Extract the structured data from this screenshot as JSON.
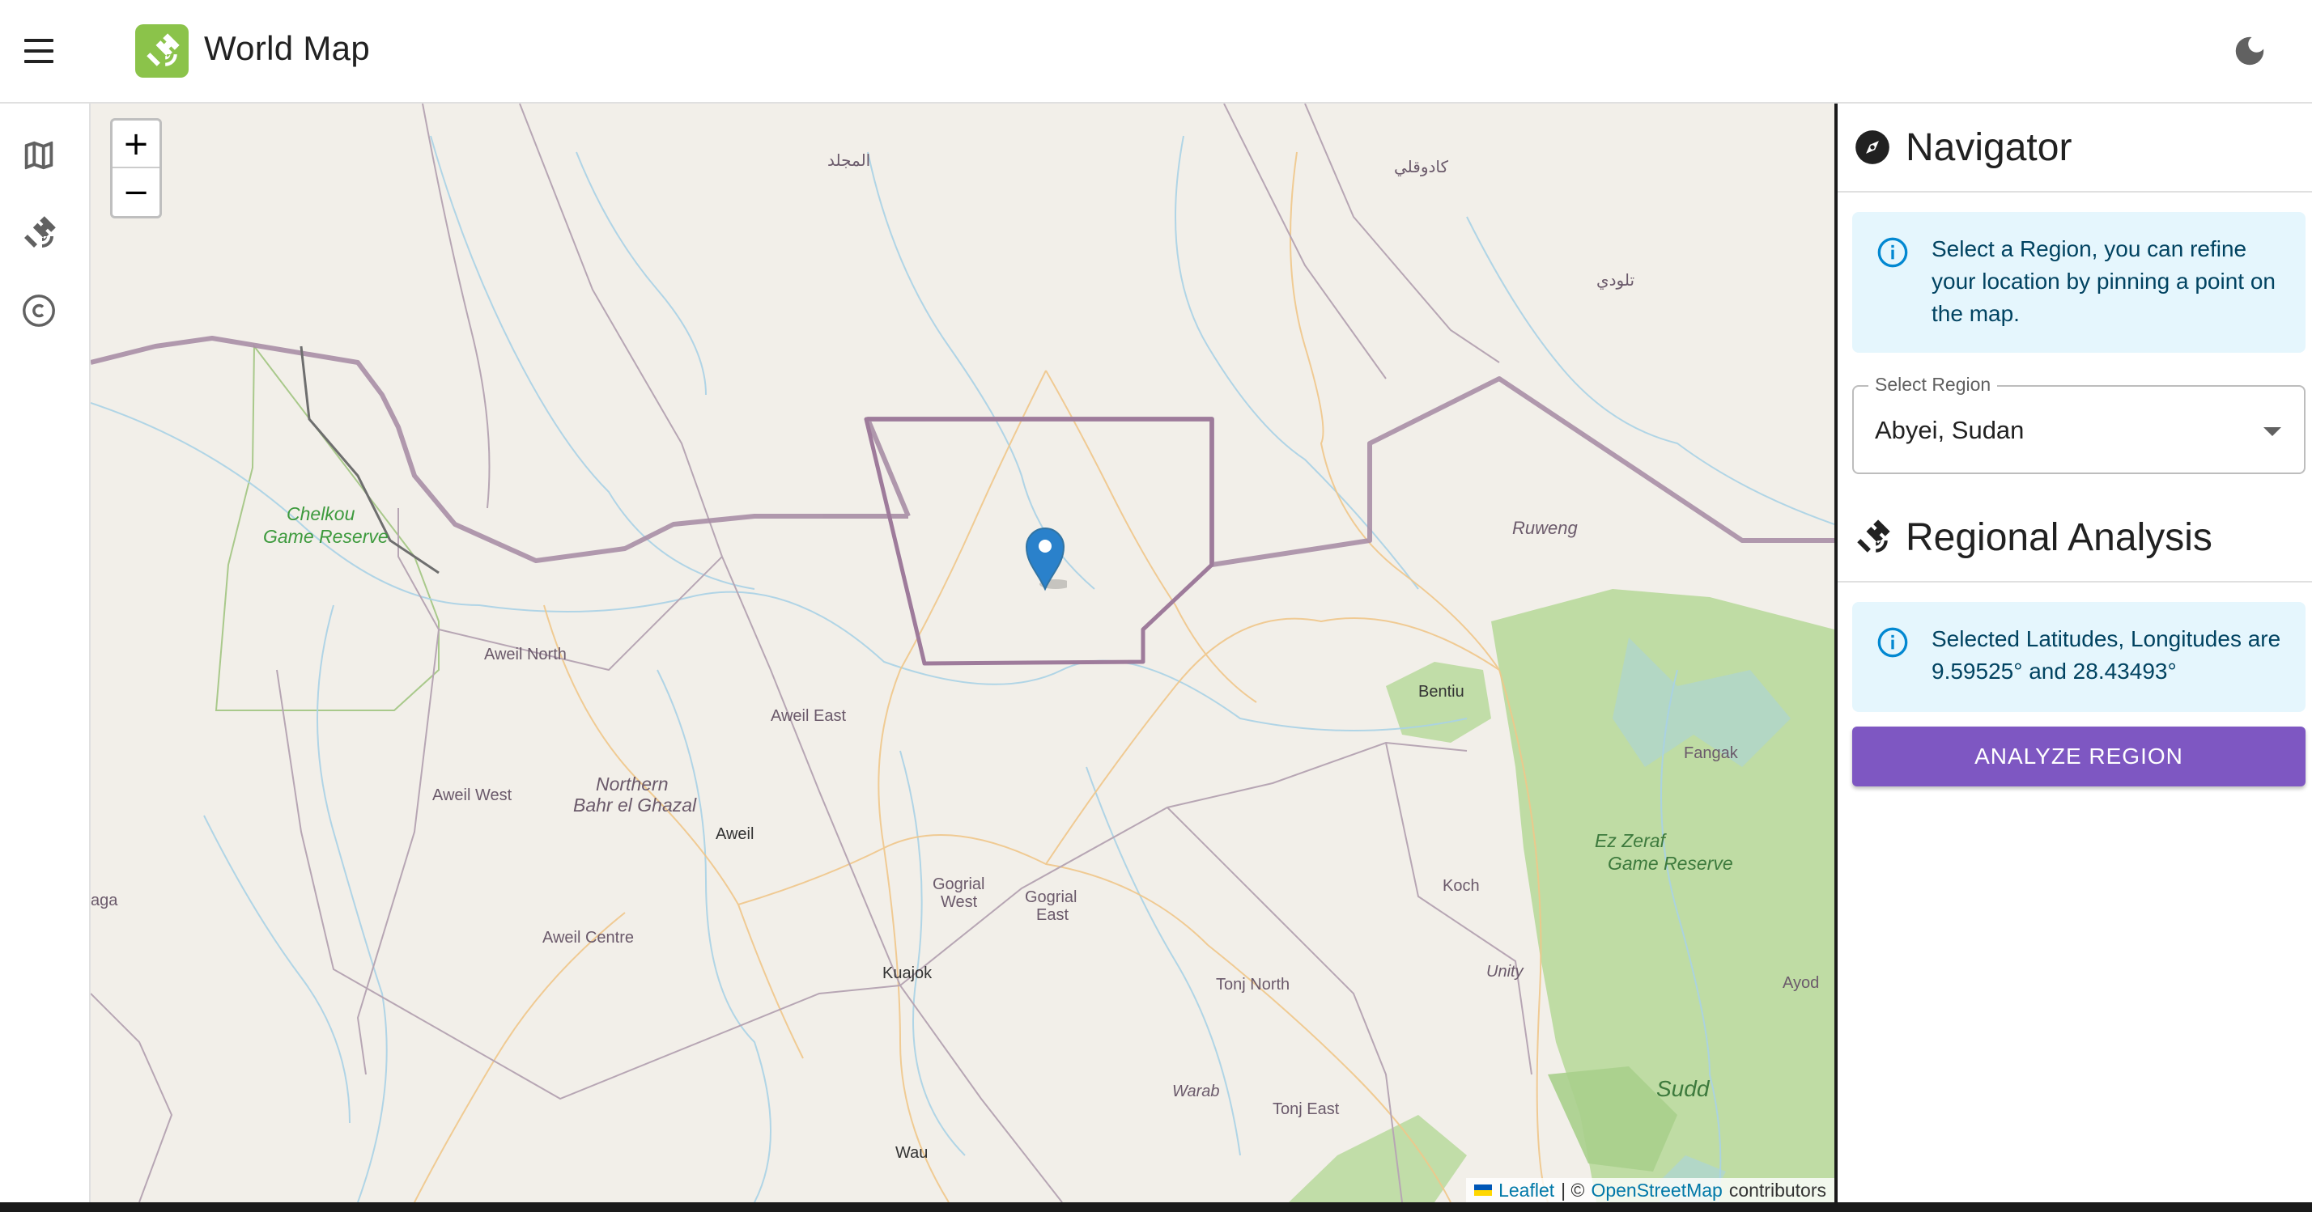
{
  "app": {
    "title": "World Map",
    "logo_icon": "satellite-icon",
    "accent": "#8bc34a"
  },
  "header": {
    "menu_icon": "menu-icon",
    "theme_icon": "moon-icon"
  },
  "rail": {
    "items": [
      {
        "icon": "map-icon"
      },
      {
        "icon": "satellite-icon"
      },
      {
        "icon": "copyright-icon"
      }
    ]
  },
  "map": {
    "zoom_in": "+",
    "zoom_out": "−",
    "attribution": {
      "leaflet": "Leaflet",
      "separator": "| ©",
      "osm": "OpenStreetMap",
      "suffix": "contributors"
    },
    "labels": [
      {
        "name": "المجلد"
      },
      {
        "name": "كادوقلي"
      },
      {
        "name": "تلودي"
      },
      {
        "name": "Chelkou"
      },
      {
        "name": "Game Reserve"
      },
      {
        "name": "Ruweng"
      },
      {
        "name": "Aweil North"
      },
      {
        "name": "Aweil East"
      },
      {
        "name": "Bentiu"
      },
      {
        "name": "Fangak"
      },
      {
        "name": "Aweil West"
      },
      {
        "name": "Northern"
      },
      {
        "name": "Bahr el Ghazal"
      },
      {
        "name": "Aweil"
      },
      {
        "name": "Ez Zeraf"
      },
      {
        "name": "Game Reserve"
      },
      {
        "name": "Gogrial"
      },
      {
        "name": "West"
      },
      {
        "name": "Gogrial"
      },
      {
        "name": "East"
      },
      {
        "name": "Koch"
      },
      {
        "name": "aga"
      },
      {
        "name": "Aweil Centre"
      },
      {
        "name": "Kuajok"
      },
      {
        "name": "Unity"
      },
      {
        "name": "Ayod"
      },
      {
        "name": "Tonj North"
      },
      {
        "name": "Warab"
      },
      {
        "name": "Tonj East"
      },
      {
        "name": "Sudd"
      },
      {
        "name": "Wau"
      }
    ]
  },
  "navigator": {
    "title": "Navigator",
    "icon": "compass-icon",
    "info": "Select a Region, you can refine your location by pinning a point on the map.",
    "select_label": "Select Region",
    "select_value": "Abyei, Sudan"
  },
  "analysis": {
    "title": "Regional Analysis",
    "icon": "satellite-icon",
    "info": "Selected Latitudes, Longitudes are 9.59525° and 28.43493°",
    "button": "Analyze Region",
    "button_color": "#7e57c2"
  }
}
